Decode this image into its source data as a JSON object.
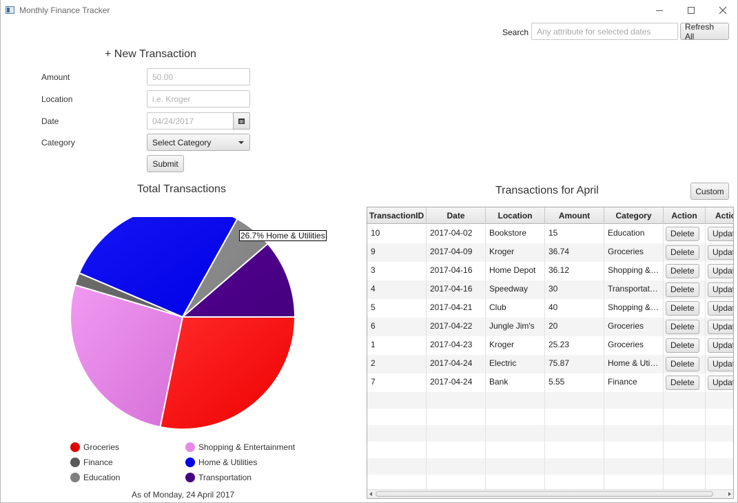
{
  "window": {
    "title": "Monthly Finance Tracker"
  },
  "search": {
    "label": "Search",
    "placeholder": "Any attribute for selected dates",
    "value": "",
    "refresh_label": "Refresh All"
  },
  "form": {
    "title": "+ New Transaction",
    "amount_label": "Amount",
    "amount_placeholder": "50.00",
    "location_label": "Location",
    "location_placeholder": "i.e. Kroger",
    "date_label": "Date",
    "date_placeholder": "04/24/2017",
    "category_label": "Category",
    "category_selected": "Select Category",
    "submit_label": "Submit",
    "calendar_icon": "calendar-icon"
  },
  "chart_title": "Total Transactions",
  "tooltip": "26.7% Home & Utilities",
  "as_of": "As of Monday, 24 April 2017",
  "chart_data": {
    "type": "pie",
    "title": "Total Transactions",
    "legend_position": "bottom",
    "start_angle_deg": 0,
    "direction": "clockwise",
    "slices": [
      {
        "label": "Groceries",
        "percent": 28.2,
        "color": "#ee0000",
        "color_light": "#ff2a2a"
      },
      {
        "label": "Shopping & Entertainment",
        "percent": 26.4,
        "color": "#d66fd8",
        "color_light": "#f09af2"
      },
      {
        "label": "Finance",
        "percent": 1.8,
        "color": "#606060",
        "color_light": "#6c6c6c"
      },
      {
        "label": "Home & Utilities",
        "percent": 26.7,
        "color": "#0000e6",
        "color_light": "#1515f5"
      },
      {
        "label": "Education",
        "percent": 5.6,
        "color": "#7f7f7f",
        "color_light": "#8f8f8f"
      },
      {
        "label": "Transportation",
        "percent": 11.3,
        "color": "#45007f",
        "color_light": "#520090"
      }
    ],
    "legend": [
      {
        "label": "Groceries",
        "color": "#e00000"
      },
      {
        "label": "Shopping & Entertainment",
        "color": "#e48ae6"
      },
      {
        "label": "Finance",
        "color": "#5a5a5a"
      },
      {
        "label": "Home & Utilities",
        "color": "#0000e6"
      },
      {
        "label": "Education",
        "color": "#7f7f7f"
      },
      {
        "label": "Transportation",
        "color": "#45007f"
      }
    ]
  },
  "table_title": "Transactions for April",
  "custom_label": "Custom",
  "table": {
    "columns": [
      "TransactionID",
      "Date",
      "Location",
      "Amount",
      "Category",
      "Action",
      "Action"
    ],
    "delete_label": "Delete",
    "update_label": "Update",
    "rows": [
      {
        "id": "10",
        "date": "2017-04-02",
        "location": "Bookstore",
        "amount": "15",
        "category": "Education"
      },
      {
        "id": "9",
        "date": "2017-04-09",
        "location": "Kroger",
        "amount": "36.74",
        "category": "Groceries"
      },
      {
        "id": "3",
        "date": "2017-04-16",
        "location": "Home Depot",
        "amount": "36.12",
        "category": "Shopping & Entertainment"
      },
      {
        "id": "4",
        "date": "2017-04-16",
        "location": "Speedway",
        "amount": "30",
        "category": "Transportation"
      },
      {
        "id": "5",
        "date": "2017-04-21",
        "location": "Club",
        "amount": "40",
        "category": "Shopping & Entertainment"
      },
      {
        "id": "6",
        "date": "2017-04-22",
        "location": "Jungle Jim's",
        "amount": "20",
        "category": "Groceries"
      },
      {
        "id": "1",
        "date": "2017-04-23",
        "location": "Kroger",
        "amount": "25.23",
        "category": "Groceries"
      },
      {
        "id": "2",
        "date": "2017-04-24",
        "location": "Electric",
        "amount": "75.87",
        "category": "Home & Utilities"
      },
      {
        "id": "7",
        "date": "2017-04-24",
        "location": "Bank",
        "amount": "5.55",
        "category": "Finance"
      }
    ]
  }
}
